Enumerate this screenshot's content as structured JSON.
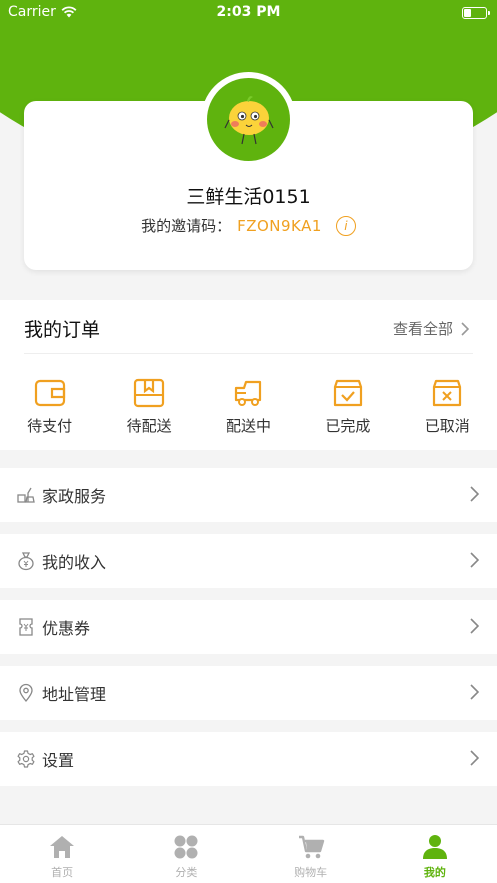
{
  "status_bar": {
    "carrier": "Carrier",
    "time": "2:03 PM"
  },
  "profile": {
    "nickname": "三鲜生活0151",
    "invite_label": "我的邀请码：",
    "invite_code": "FZON9KA1",
    "info_glyph": "i"
  },
  "orders": {
    "title": "我的订单",
    "view_all": "查看全部",
    "statuses": [
      {
        "label": "待支付",
        "icon": "wallet-icon"
      },
      {
        "label": "待配送",
        "icon": "package-icon"
      },
      {
        "label": "配送中",
        "icon": "truck-icon"
      },
      {
        "label": "已完成",
        "icon": "check-box-icon"
      },
      {
        "label": "已取消",
        "icon": "cancel-box-icon"
      }
    ]
  },
  "menu": [
    {
      "label": "家政服务",
      "icon": "housekeeping-icon"
    },
    {
      "label": "我的收入",
      "icon": "money-bag-icon"
    },
    {
      "label": "优惠券",
      "icon": "coupon-icon"
    },
    {
      "label": "地址管理",
      "icon": "location-pin-icon"
    },
    {
      "label": "设置",
      "icon": "settings-icon"
    }
  ],
  "tabs": [
    {
      "label": "首页",
      "icon": "home-icon",
      "active": false
    },
    {
      "label": "分类",
      "icon": "category-icon",
      "active": false
    },
    {
      "label": "购物车",
      "icon": "cart-icon",
      "active": false
    },
    {
      "label": "我的",
      "icon": "user-icon",
      "active": true
    }
  ],
  "colors": {
    "brand_green": "#5fb30e",
    "accent_orange": "#f0a020",
    "inactive_gray": "#b0b0b0"
  }
}
